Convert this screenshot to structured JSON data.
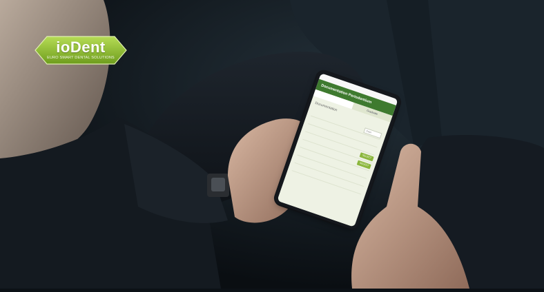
{
  "logo": {
    "name": "ioDent",
    "tagline": "EURO SMART DENTAL SOLUTIONS"
  },
  "colors": {
    "logo_green": "#8bbf2a",
    "app_header_green": "#3e7a2f",
    "background": "#0c1116"
  },
  "phone": {
    "header_title": "Documentation Periodontium",
    "tab_label": "Graduate",
    "title": "Documentation",
    "select_value": "Days",
    "buttons": [
      "SELECT",
      "SELECT"
    ]
  }
}
